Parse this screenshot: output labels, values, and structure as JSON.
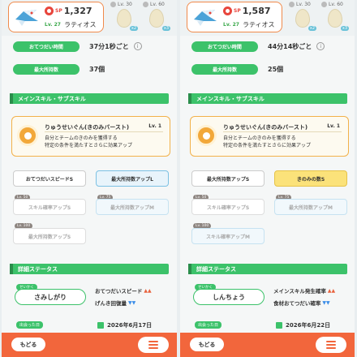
{
  "left": {
    "sp_label": "SP",
    "sp_value": "1,327",
    "level": "Lv. 27",
    "name": "ラティオス",
    "eggs": [
      {
        "level": "Lv. 30",
        "count": "x2"
      },
      {
        "level": "Lv. 60",
        "count": "x3"
      }
    ],
    "help_time_label": "おてつだい時間",
    "help_time": "37分1秒ごと",
    "max_carry_label": "最大所持数",
    "max_carry": "37個",
    "skill_section": "メインスキル・サブスキル",
    "main_skill": {
      "name": "りゅうせいぐん(きのみバースト)",
      "level": "Lv. 1",
      "desc": "自分とチームのきのみを獲得する\n特定の条件を満たすとさらに効果アップ"
    },
    "subs": [
      {
        "label": "おてつだいスピードS",
        "lock": ""
      },
      {
        "label": "最大所持数アップL",
        "lock": ""
      },
      {
        "label": "スキル確率アップS",
        "lock": "Lv. 50"
      },
      {
        "label": "最大所持数アップM",
        "lock": "Lv. 75"
      },
      {
        "label": "最大所持数アップS",
        "lock": "Lv. 100"
      }
    ],
    "detail_section": "詳細ステータス",
    "nature_label": "せいかく",
    "nature": "さみしがり",
    "effects": [
      {
        "label": "おてつだいスピード",
        "dir": "up"
      },
      {
        "label": "げんき回復量",
        "dir": "down"
      }
    ],
    "caught_label": "出会った日",
    "caught_date": "2026年6月17日",
    "back": "もどる"
  },
  "right": {
    "sp_label": "SP",
    "sp_value": "1,587",
    "level": "Lv. 27",
    "name": "ラティオス",
    "eggs": [
      {
        "level": "Lv. 30",
        "count": "x2"
      },
      {
        "level": "Lv. 60",
        "count": "x3"
      }
    ],
    "help_time_label": "おてつだい時間",
    "help_time": "44分14秒ごと",
    "max_carry_label": "最大所持数",
    "max_carry": "25個",
    "skill_section": "メインスキル・サブスキル",
    "main_skill": {
      "name": "りゅうせいぐん(きのみバースト)",
      "level": "Lv. 1",
      "desc": "自分とチームのきのみを獲得する\n特定の条件を満たすとさらに効果アップ"
    },
    "subs": [
      {
        "label": "最大所持数アップS",
        "lock": ""
      },
      {
        "label": "きのみの数S",
        "lock": ""
      },
      {
        "label": "スキル確率アップS",
        "lock": "Lv. 50"
      },
      {
        "label": "最大所持数アップM",
        "lock": "Lv. 75"
      },
      {
        "label": "スキル確率アップM",
        "lock": "Lv. 100"
      }
    ],
    "detail_section": "詳細ステータス",
    "nature_label": "せいかく",
    "nature": "しんちょう",
    "effects": [
      {
        "label": "メインスキル発生確率",
        "dir": "up"
      },
      {
        "label": "食材おてつだい確率",
        "dir": "down"
      }
    ],
    "caught_label": "出会った日",
    "caught_date": "2026年6月22日",
    "back": "もどる"
  },
  "icons": {
    "pokemon": "latios-icon",
    "sp": "sp-badge-icon",
    "egg": "egg-icon",
    "info": "info-icon",
    "skill": "berry-burst-icon",
    "calendar": "calendar-icon",
    "menu": "hamburger-menu-icon"
  },
  "colors": {
    "accent": "#3cc26a",
    "bottom": "#f2663c",
    "skill_border": "#f2b14a",
    "up": "#e8613c",
    "down": "#3c8ee8"
  }
}
